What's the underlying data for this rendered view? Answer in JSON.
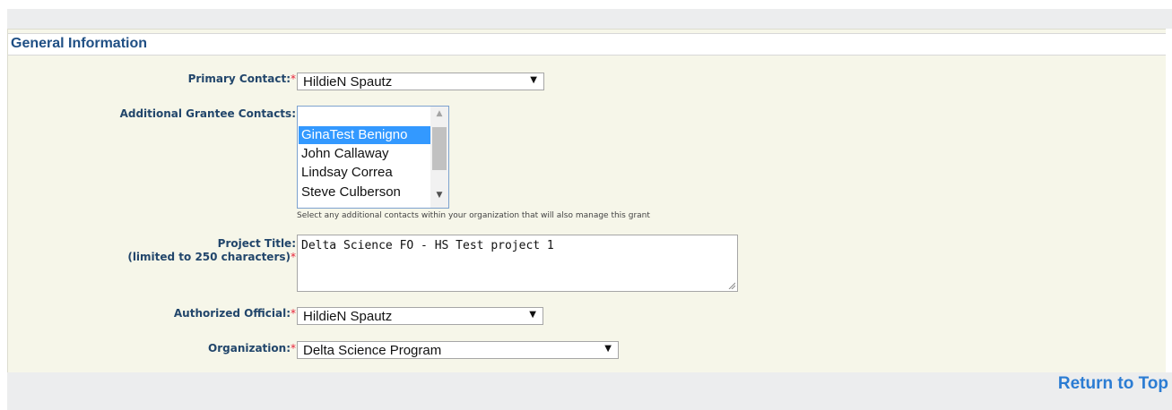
{
  "section": {
    "title": "General Information"
  },
  "fields": {
    "primary_contact": {
      "label": "Primary Contact:",
      "required": "*",
      "value": "HildieN Spautz"
    },
    "additional_contacts": {
      "label": "Additional Grantee Contacts:",
      "options": [
        {
          "label": "",
          "selected": false
        },
        {
          "label": "GinaTest Benigno",
          "selected": true
        },
        {
          "label": "John Callaway",
          "selected": false
        },
        {
          "label": "Lindsay Correa",
          "selected": false
        },
        {
          "label": "Steve Culberson",
          "selected": false
        }
      ],
      "hint": "Select any additional contacts within your organization that will also manage this grant"
    },
    "project_title": {
      "label": "Project Title:",
      "sublabel": "(limited to 250 characters)",
      "required": "*",
      "value": "Delta Science FO - HS Test project 1"
    },
    "authorized_official": {
      "label": "Authorized Official:",
      "required": "*",
      "value": "HildieN Spautz"
    },
    "organization": {
      "label": "Organization:",
      "required": "*",
      "value": "Delta Science Program"
    }
  },
  "footer": {
    "return_to_top": "Return to Top"
  },
  "icons": {
    "select_arrow": "▼",
    "scroll_up": "▲",
    "scroll_down": "▼"
  },
  "colors": {
    "label": "#22466b",
    "header_text": "#1f4f84",
    "required": "#e8233b",
    "link": "#2b7cd3",
    "panel_bg": "#f6f6e9",
    "selection": "#3399ff"
  }
}
